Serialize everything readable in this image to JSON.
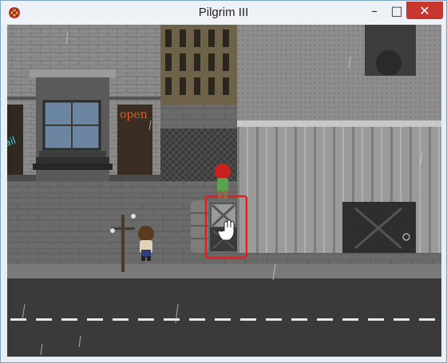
{
  "window": {
    "title": "Pilgrim III",
    "controls": {
      "minimize": "–",
      "maximize": "□",
      "close": "✕"
    }
  },
  "scene": {
    "shop_sign": "open",
    "colors": {
      "sky_wall": "#8a8a8a",
      "sidewalk": "#6e6e6e",
      "road": "#3a3a3a",
      "lane_marking": "#e8e8e8",
      "selection": "#e02020",
      "neon": "#e05a2a"
    }
  },
  "icons": [
    "app-icon",
    "cursor-hand-icon"
  ]
}
